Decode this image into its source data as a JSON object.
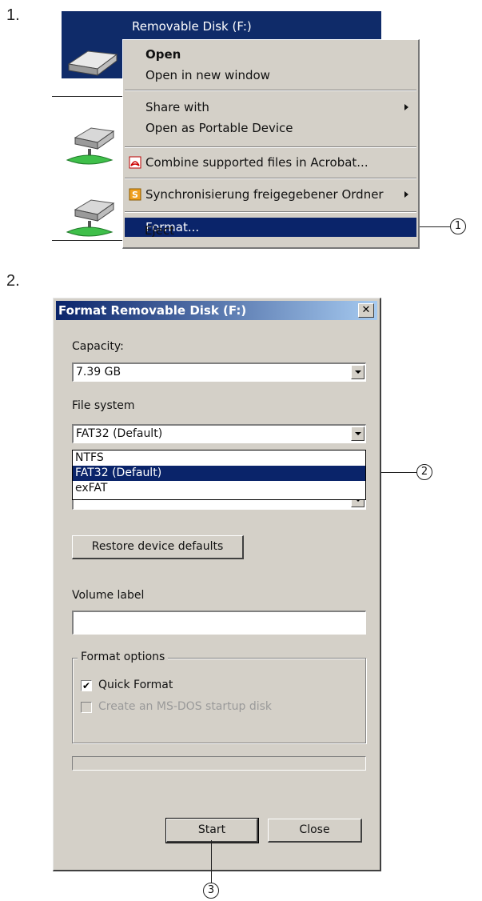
{
  "steps": {
    "step1": "1.",
    "step2": "2."
  },
  "explorer": {
    "selected_drive": "Removable Disk (F:)"
  },
  "context_menu": {
    "items": [
      {
        "label": "Open",
        "bold": true
      },
      {
        "label": "Open in new window"
      },
      {
        "label": "Share with",
        "submenu": true
      },
      {
        "label": "Open as Portable Device"
      },
      {
        "label": "Combine supported files in Acrobat...",
        "icon": "acrobat-icon"
      },
      {
        "label": "Synchronisierung freigegebener Ordner",
        "icon": "sync-folder-icon",
        "submenu": true
      },
      {
        "label": "Format...",
        "highlighted": true
      },
      {
        "label": "Eject"
      }
    ]
  },
  "callouts": {
    "one": "1",
    "two": "2",
    "three": "3"
  },
  "dialog": {
    "title": "Format Removable Disk (F:)",
    "close_glyph": "✕",
    "capacity_label": "Capacity:",
    "capacity_value": "7.39 GB",
    "filesystem_label": "File system",
    "filesystem_value": "FAT32 (Default)",
    "filesystem_options": [
      "NTFS",
      "FAT32 (Default)",
      "exFAT"
    ],
    "filesystem_highlighted": "FAT32 (Default)",
    "restore_button": "Restore device defaults",
    "volume_label": "Volume label",
    "volume_value": "",
    "format_options_label": "Format options",
    "quick_format": {
      "label": "Quick Format",
      "checked": true
    },
    "msdos_startup": {
      "label": "Create an MS-DOS startup disk",
      "checked": false,
      "disabled": true
    },
    "progress": 0,
    "start_button": "Start",
    "close_button": "Close"
  },
  "colors": {
    "selection": "#0a246a",
    "dialog_face": "#d4d0c8",
    "explorer_selection": "#0f2b69"
  }
}
